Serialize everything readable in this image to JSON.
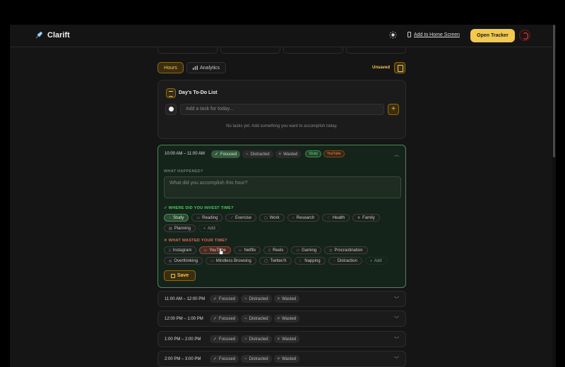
{
  "header": {
    "brand": "Clarift",
    "add_home": "Add to Home Screen",
    "open_tracker": "Open Tracker"
  },
  "tabs": {
    "hours": "Hours",
    "analytics": "Analytics",
    "unsaved": "Unsaved"
  },
  "todo": {
    "title": "Day's To-Do List",
    "placeholder": "Add a task for today...",
    "add_symbol": "+",
    "empty": "No tasks yet. Add something you want to accomplish today."
  },
  "status_labels": {
    "focused": "Focused",
    "distracted": "Distracted",
    "wasted": "Wasted",
    "focused_mark": "✓",
    "distracted_mark": "~",
    "wasted_mark": "×"
  },
  "open_hour": {
    "time": "10:00 AM – 11:00 AM",
    "tag_study": "Study",
    "tag_youtube": "YouTube",
    "what_happened": "WHAT HAPPENED?",
    "textarea_placeholder": "What did you accomplish this hour?",
    "invest_label": "✓ WHERE DID YOU INVEST TIME?",
    "invest_chips": [
      "Study",
      "Reading",
      "Exercise",
      "Work",
      "Research",
      "Health",
      "Family",
      "Planning",
      "Add"
    ],
    "wasted_label": "✕ WHAT WASTED YOUR TIME?",
    "wasted_chips": [
      "Instagram",
      "YouTube",
      "Netflix",
      "Reels",
      "Gaming",
      "Procrastination",
      "Overthinking",
      "Mindless Browsing",
      "Twitter/X",
      "Napping",
      "Distraction",
      "Add"
    ],
    "save": "Save"
  },
  "hours": [
    {
      "time": "11:00 AM – 12:00 PM"
    },
    {
      "time": "12:00 PM – 1:00 PM"
    },
    {
      "time": "1:00 PM – 2:00 PM"
    },
    {
      "time": "2:00 PM – 3:00 PM"
    }
  ],
  "colors": {
    "accent": "#f2c94c",
    "good": "#3e8f50",
    "bad": "#e05555"
  }
}
